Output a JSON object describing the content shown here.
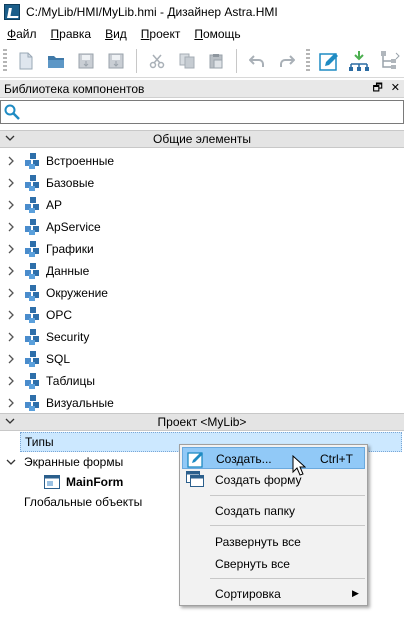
{
  "window": {
    "title": "C:/MyLib/HMI/MyLib.hmi - Дизайнер Astra.HMI"
  },
  "menubar": {
    "items": [
      {
        "underline": "Ф",
        "rest": "айл"
      },
      {
        "underline": "П",
        "rest": "равка"
      },
      {
        "underline": "В",
        "rest": "ид"
      },
      {
        "underline": "П",
        "rest": "роект"
      },
      {
        "underline": "П",
        "rest": "омощь"
      }
    ]
  },
  "toolbar": {
    "buttons": [
      "new-document-icon",
      "open-folder-icon",
      "save-icon",
      "save-all-icon",
      "cut-icon",
      "copy-icon",
      "paste-icon",
      "undo-icon",
      "redo-icon",
      "edit-icon",
      "network-add-icon",
      "network-tree-icon"
    ]
  },
  "panel": {
    "title": "Библиотека компонентов",
    "restore_glyph": "🗗",
    "close_glyph": "✕"
  },
  "search": {
    "value": "",
    "placeholder": ""
  },
  "common_section": {
    "title": "Общие элементы",
    "items": [
      "Встроенные",
      "Базовые",
      "AP",
      "ApService",
      "Графики",
      "Данные",
      "Окружение",
      "OPC",
      "Security",
      "SQL",
      "Таблицы",
      "Визуальные"
    ]
  },
  "project_section": {
    "title": "Проект <MyLib>",
    "types_label": "Типы",
    "screen_forms_label": "Экранные формы",
    "main_form_label": "MainForm",
    "global_objects_label": "Глобальные объекты"
  },
  "context_menu": {
    "create": "Создать...",
    "create_shortcut": "Ctrl+T",
    "create_form": "Создать форму",
    "create_folder": "Создать папку",
    "expand_all": "Развернуть все",
    "collapse_all": "Свернуть все",
    "sort": "Сортировка"
  },
  "colors": {
    "accent": "#1e8bc3",
    "selection": "#cce8ff",
    "menu_highlight": "#91c9f7"
  }
}
